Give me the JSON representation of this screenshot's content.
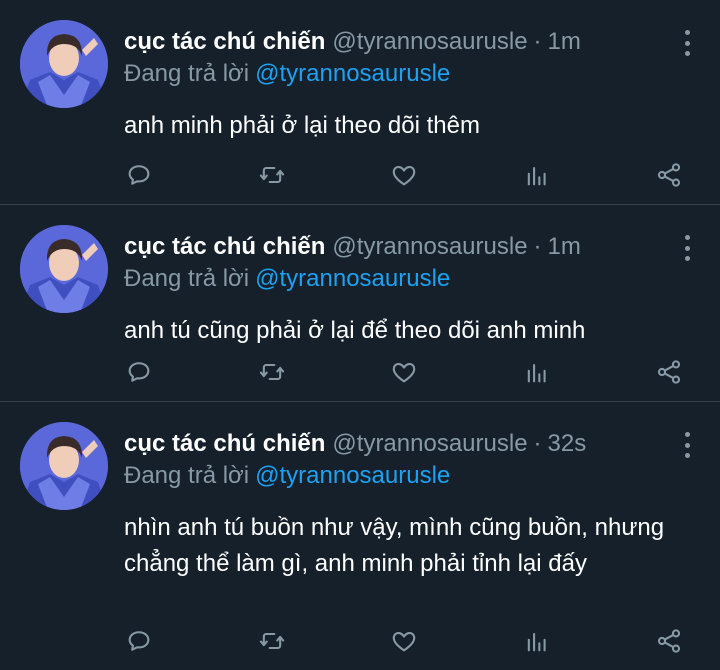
{
  "tweets": [
    {
      "author_name": "cục tác chú chiến",
      "author_handle": "@tyrannosaurusle",
      "separator": "·",
      "time": "1m",
      "replying_to_label": "Đang trả lời",
      "replying_to_handle": "@tyrannosaurusle",
      "text": "anh minh phải ở lại theo dõi thêm"
    },
    {
      "author_name": "cục tác chú chiến",
      "author_handle": "@tyrannosaurusle",
      "separator": "·",
      "time": "1m",
      "replying_to_label": "Đang trả lời",
      "replying_to_handle": "@tyrannosaurusle",
      "text": "anh tú cũng phải ở lại để theo dõi anh minh"
    },
    {
      "author_name": "cục tác chú chiến",
      "author_handle": "@tyrannosaurusle",
      "separator": "·",
      "time": "32s",
      "replying_to_label": "Đang trả lời",
      "replying_to_handle": "@tyrannosaurusle",
      "text": "nhìn anh tú buồn như vậy, mình cũng buồn, nhưng chẳng thể làm gì, anh minh phải tỉnh lại đấy"
    }
  ],
  "icons": {
    "reply": "reply-icon",
    "retweet": "retweet-icon",
    "like": "heart-icon",
    "analytics": "analytics-icon",
    "share": "share-icon",
    "more": "more-vertical-icon"
  },
  "colors": {
    "background": "#15202b",
    "secondary_text": "#8899a6",
    "link": "#1da1f2",
    "divider": "#38444d"
  }
}
